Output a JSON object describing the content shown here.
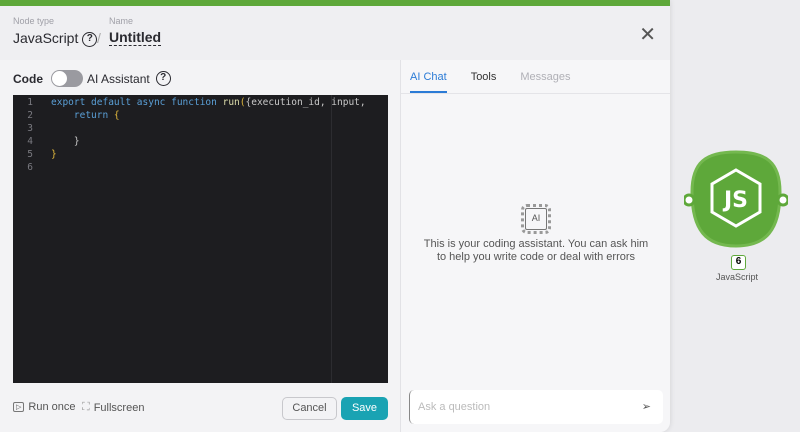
{
  "header": {
    "node_type_label": "Node type",
    "node_type": "JavaScript",
    "name_label": "Name",
    "name": "Untitled",
    "separator": "/"
  },
  "code": {
    "label": "Code",
    "ai_toggle_label": "AI Assistant",
    "ai_enabled": false,
    "lines": [
      {
        "n": "1",
        "parts": [
          [
            "kw",
            "export default async function "
          ],
          [
            "fn",
            "run"
          ],
          [
            "br",
            "("
          ],
          [
            "tx",
            "{execution_id, input,"
          ]
        ]
      },
      {
        "n": "2",
        "parts": [
          [
            "kw",
            "    return "
          ],
          [
            "br",
            "{"
          ]
        ]
      },
      {
        "n": "3",
        "parts": []
      },
      {
        "n": "4",
        "parts": [
          [
            "tx",
            "    }"
          ]
        ]
      },
      {
        "n": "5",
        "parts": [
          [
            "br",
            "}"
          ]
        ]
      },
      {
        "n": "6",
        "parts": []
      }
    ]
  },
  "footer": {
    "run_once": "Run once",
    "fullscreen": "Fullscreen",
    "cancel": "Cancel",
    "save": "Save"
  },
  "tabs": [
    {
      "label": "AI Chat",
      "state": "active"
    },
    {
      "label": "Tools",
      "state": "normal"
    },
    {
      "label": "Messages",
      "state": "disabled"
    }
  ],
  "chat": {
    "icon_text": "AI",
    "empty_text": "This is your coding assistant. You can ask him to help you write code or deal with errors",
    "placeholder": "Ask a question"
  },
  "node": {
    "label": "JavaScript",
    "badge": "6",
    "icon": "nodejs-icon"
  },
  "colors": {
    "accent_green": "#5ea83a",
    "save": "#1aa3b3",
    "tab_active": "#2b7bd6"
  }
}
